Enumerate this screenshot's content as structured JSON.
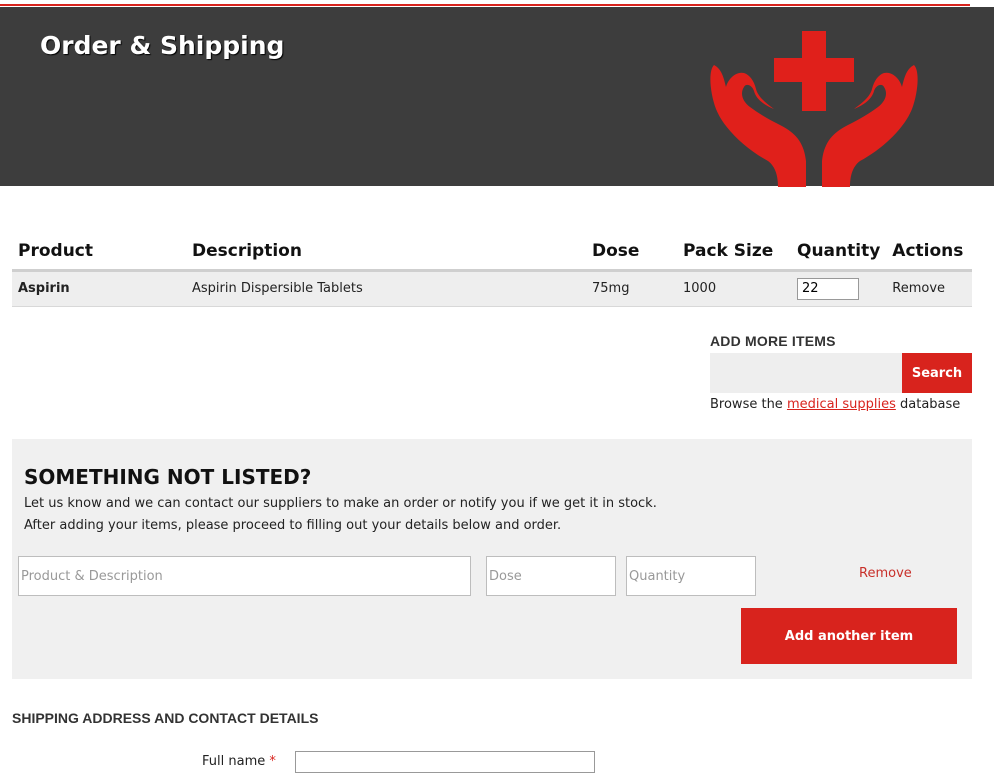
{
  "header": {
    "title": "Order & Shipping",
    "accent_color": "#d8231d",
    "banner_color": "#3d3d3d",
    "logo_icon": "hands-holding-cross-icon"
  },
  "cart": {
    "columns": [
      "Product",
      "Description",
      "Dose",
      "Pack Size",
      "Quantity",
      "Actions"
    ],
    "rows": [
      {
        "product": "Aspirin",
        "description": "Aspirin Dispersible Tablets",
        "dose": "75mg",
        "pack_size": "1000",
        "quantity": "22",
        "action": "Remove"
      }
    ]
  },
  "add_more": {
    "title": "ADD MORE ITEMS",
    "search_value": "",
    "search_button": "Search",
    "browse_prefix": "Browse the",
    "browse_link": "medical supplies",
    "browse_suffix": "database"
  },
  "not_listed": {
    "title": "SOMETHING NOT LISTED?",
    "line1": "Let us know and we can contact our suppliers to make an order or notify you if we get it in stock.",
    "line2": "After adding your items, please proceed to filling out your details below and order.",
    "product_placeholder": "Product & Description",
    "dose_placeholder": "Dose",
    "quantity_placeholder": "Quantity",
    "remove_label": "Remove",
    "add_button": "Add another item"
  },
  "shipping": {
    "title": "SHIPPING ADDRESS AND CONTACT DETAILS",
    "full_name_label": "Full name",
    "required_marker": "*",
    "full_name_value": ""
  }
}
